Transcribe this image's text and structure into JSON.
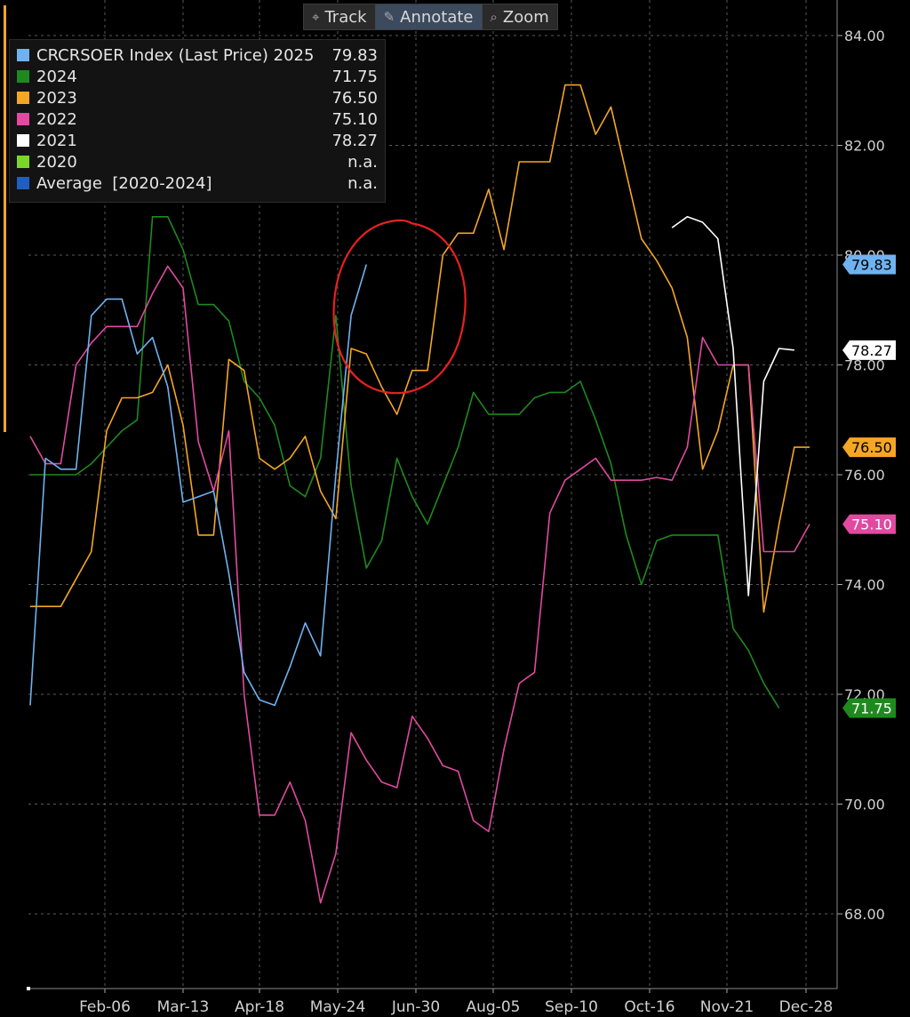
{
  "toolbar": {
    "items": [
      {
        "label": "Track",
        "icon": "crosshair-icon",
        "active": false
      },
      {
        "label": "Annotate",
        "icon": "pencil-icon",
        "active": true
      },
      {
        "label": "Zoom",
        "icon": "magnifier-icon",
        "active": false
      }
    ]
  },
  "legend": {
    "rows": [
      {
        "name": "CRCRSOER Index (Last Price) 2025",
        "value": "79.83",
        "color": "#6fb2f0"
      },
      {
        "name": "2024",
        "value": "71.75",
        "color": "#1e8a1e"
      },
      {
        "name": "2023",
        "value": "76.50",
        "color": "#f5a623"
      },
      {
        "name": "2022",
        "value": "75.10",
        "color": "#e04aa0"
      },
      {
        "name": "2021",
        "value": "78.27",
        "color": "#ffffff"
      },
      {
        "name": "2020",
        "value": "n.a.",
        "color": "#7cd62a"
      },
      {
        "name": "Average  [2020-2024]",
        "value": "n.a.",
        "color": "#1f5fbf"
      }
    ]
  },
  "chart_data": {
    "type": "line",
    "ylim": [
      66.5,
      84.5
    ],
    "y_ticks": [
      "68.00",
      "70.00",
      "72.00",
      "74.00",
      "76.00",
      "78.00",
      "80.00",
      "82.00",
      "84.00"
    ],
    "x_ticks": [
      "Feb-06",
      "Mar-13",
      "Apr-18",
      "May-24",
      "Jun-30",
      "Aug-05",
      "Sep-10",
      "Oct-16",
      "Nov-21",
      "Dec-28"
    ],
    "grid": true,
    "legend_position": "top-left",
    "series": [
      {
        "name": "2025",
        "color": "#6fb2f0",
        "last_label": "79.83",
        "values": [
          71.8,
          76.3,
          76.1,
          76.1,
          78.9,
          79.2,
          79.2,
          78.2,
          78.5,
          77.6,
          75.5,
          75.6,
          75.7,
          74.2,
          72.4,
          71.9,
          71.8,
          72.5,
          73.3,
          72.7,
          76.0,
          78.9,
          79.83
        ]
      },
      {
        "name": "2024",
        "color": "#1e8a1e",
        "last_label": "71.75",
        "values": [
          76.0,
          76.0,
          76.0,
          76.0,
          76.2,
          76.5,
          76.8,
          77.0,
          80.7,
          80.7,
          80.1,
          79.1,
          79.1,
          78.8,
          77.7,
          77.4,
          76.9,
          75.8,
          75.6,
          76.3,
          78.9,
          75.8,
          74.3,
          74.8,
          76.3,
          75.6,
          75.1,
          75.8,
          76.5,
          77.5,
          77.1,
          77.1,
          77.1,
          77.4,
          77.5,
          77.5,
          77.7,
          77.0,
          76.2,
          74.9,
          74.0,
          74.8,
          74.9,
          74.9,
          74.9,
          74.9,
          73.2,
          72.8,
          72.2,
          71.75
        ]
      },
      {
        "name": "2023",
        "color": "#f5a623",
        "last_label": "76.50",
        "values": [
          73.6,
          73.6,
          73.6,
          74.1,
          74.6,
          76.8,
          77.4,
          77.4,
          77.5,
          78.0,
          76.9,
          74.9,
          74.9,
          78.1,
          77.9,
          76.3,
          76.1,
          76.3,
          76.7,
          75.7,
          75.2,
          78.3,
          78.2,
          77.6,
          77.1,
          77.9,
          77.9,
          80.0,
          80.4,
          80.4,
          81.2,
          80.1,
          81.7,
          81.7,
          81.7,
          83.1,
          83.1,
          82.2,
          82.7,
          81.5,
          80.3,
          79.9,
          79.4,
          78.5,
          76.1,
          76.8,
          78.0,
          78.0,
          73.5,
          75.1,
          76.5,
          76.5
        ]
      },
      {
        "name": "2022",
        "color": "#e04aa0",
        "last_label": "75.10",
        "values": [
          76.7,
          76.2,
          76.2,
          78.0,
          78.4,
          78.7,
          78.7,
          78.7,
          79.3,
          79.8,
          79.4,
          76.6,
          75.7,
          76.8,
          72.0,
          69.8,
          69.8,
          70.4,
          69.7,
          68.2,
          69.1,
          71.3,
          70.8,
          70.4,
          70.3,
          71.6,
          71.2,
          70.7,
          70.6,
          69.7,
          69.5,
          71.0,
          72.2,
          72.4,
          75.3,
          75.9,
          76.1,
          76.3,
          75.9,
          75.9,
          75.9,
          75.95,
          75.9,
          76.5,
          78.5,
          78.0,
          78.0,
          78.0,
          74.6,
          74.6,
          74.6,
          75.1
        ]
      },
      {
        "name": "2021",
        "color": "#ffffff",
        "last_label": "78.27",
        "values": [
          null,
          null,
          null,
          null,
          null,
          null,
          null,
          null,
          null,
          null,
          null,
          null,
          null,
          null,
          null,
          null,
          null,
          null,
          null,
          null,
          null,
          null,
          null,
          null,
          null,
          null,
          null,
          null,
          null,
          null,
          null,
          null,
          null,
          null,
          null,
          null,
          null,
          null,
          null,
          null,
          null,
          null,
          80.5,
          80.7,
          80.6,
          80.3,
          78.3,
          73.8,
          77.7,
          78.3,
          78.27
        ]
      }
    ]
  },
  "annotation": {
    "shape": "circle",
    "color": "#e82020"
  }
}
